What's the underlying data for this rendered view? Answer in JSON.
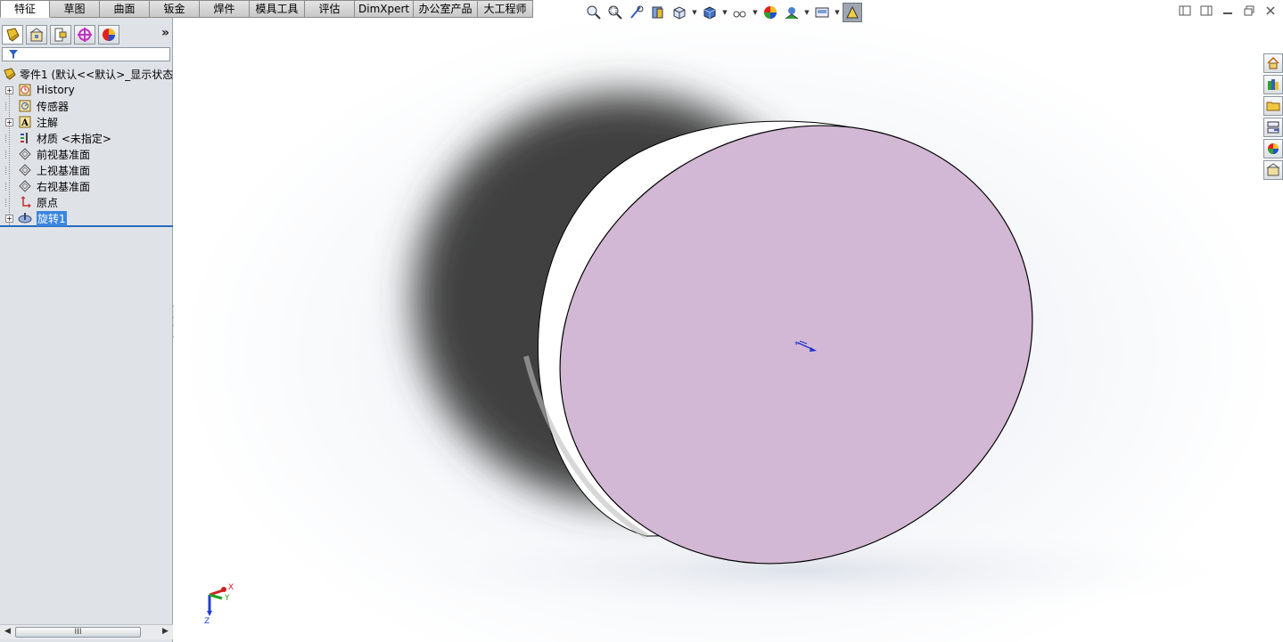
{
  "tabs": [
    "特征",
    "草图",
    "曲面",
    "钣金",
    "焊件",
    "模具工具",
    "评估",
    "DimXpert",
    "办公室产品",
    "大工程师"
  ],
  "active_tab": "特征",
  "panel": {
    "expand_label": "»",
    "tree_root": "零件1  (默认<<默认>_显示状态",
    "items": [
      {
        "label": "History",
        "icon": "history-icon",
        "expandable": true
      },
      {
        "label": "传感器",
        "icon": "sensor-icon",
        "expandable": false
      },
      {
        "label": "注解",
        "icon": "annotation-icon",
        "expandable": true
      },
      {
        "label": "材质 <未指定>",
        "icon": "material-icon",
        "expandable": false
      },
      {
        "label": "前视基准面",
        "icon": "plane-icon",
        "expandable": false
      },
      {
        "label": "上视基准面",
        "icon": "plane-icon",
        "expandable": false
      },
      {
        "label": "右视基准面",
        "icon": "plane-icon",
        "expandable": false
      },
      {
        "label": "原点",
        "icon": "origin-icon",
        "expandable": false
      },
      {
        "label": "旋转1",
        "icon": "revolve-icon",
        "expandable": true,
        "selected": true
      }
    ],
    "scroll_thumb": "III"
  },
  "triad": {
    "x": "X",
    "y": "Y",
    "z": "Z"
  },
  "colors": {
    "face": "#d2b8d4",
    "shadow": "#404040",
    "selection": "#3a86e0",
    "panel_bg": "#dfe3e8"
  }
}
